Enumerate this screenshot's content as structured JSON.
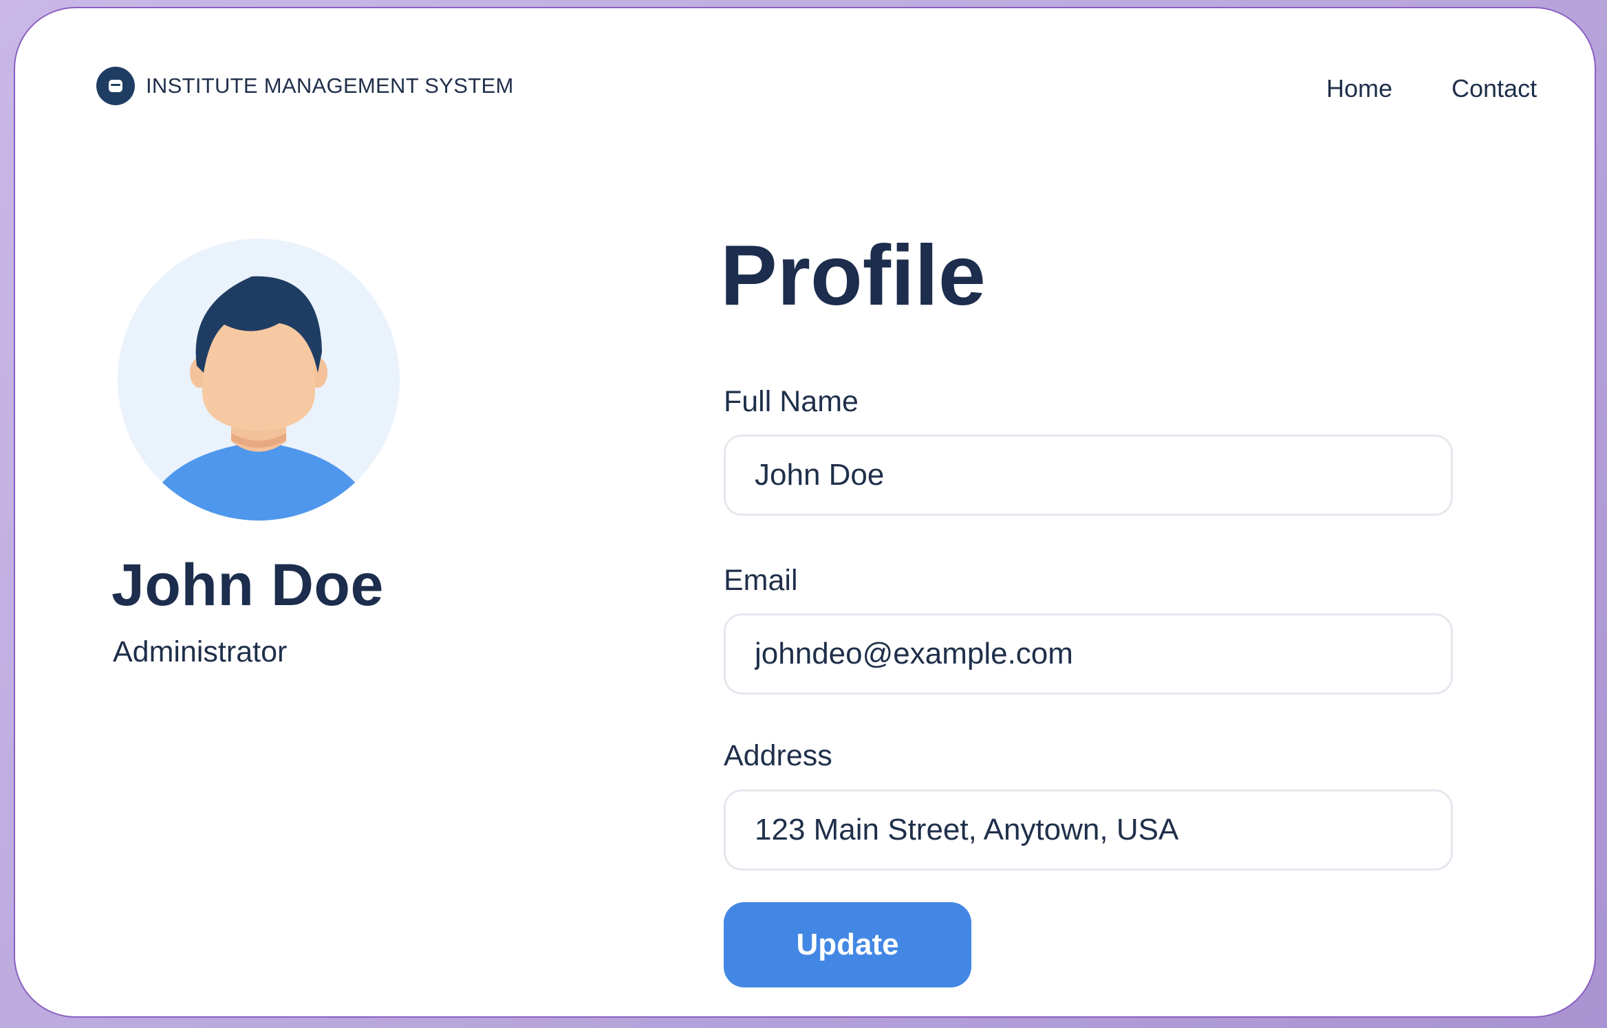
{
  "header": {
    "brand_logo_icon": "graduation-cap-icon",
    "brand_name": "INSTITUTE MANAGEMENT SYSTEM",
    "nav": {
      "home": "Home",
      "contact": "Contact"
    }
  },
  "profile_card": {
    "avatar_icon": "user-avatar-icon",
    "name": "John Doe",
    "role": "Administrator"
  },
  "form": {
    "title": "Profile",
    "fields": [
      {
        "label": "Full Name",
        "value": "John Doe"
      },
      {
        "label": "Email",
        "value": "johndeo@example.com"
      },
      {
        "label": "Address",
        "value": "123 Main Street, Anytown, USA"
      }
    ],
    "submit_label": "Update"
  },
  "colors": {
    "primary": "#4287e4",
    "navy": "#1c2d4d",
    "card_border": "#8a5fc2",
    "page_bg": "#b9a6dc"
  }
}
